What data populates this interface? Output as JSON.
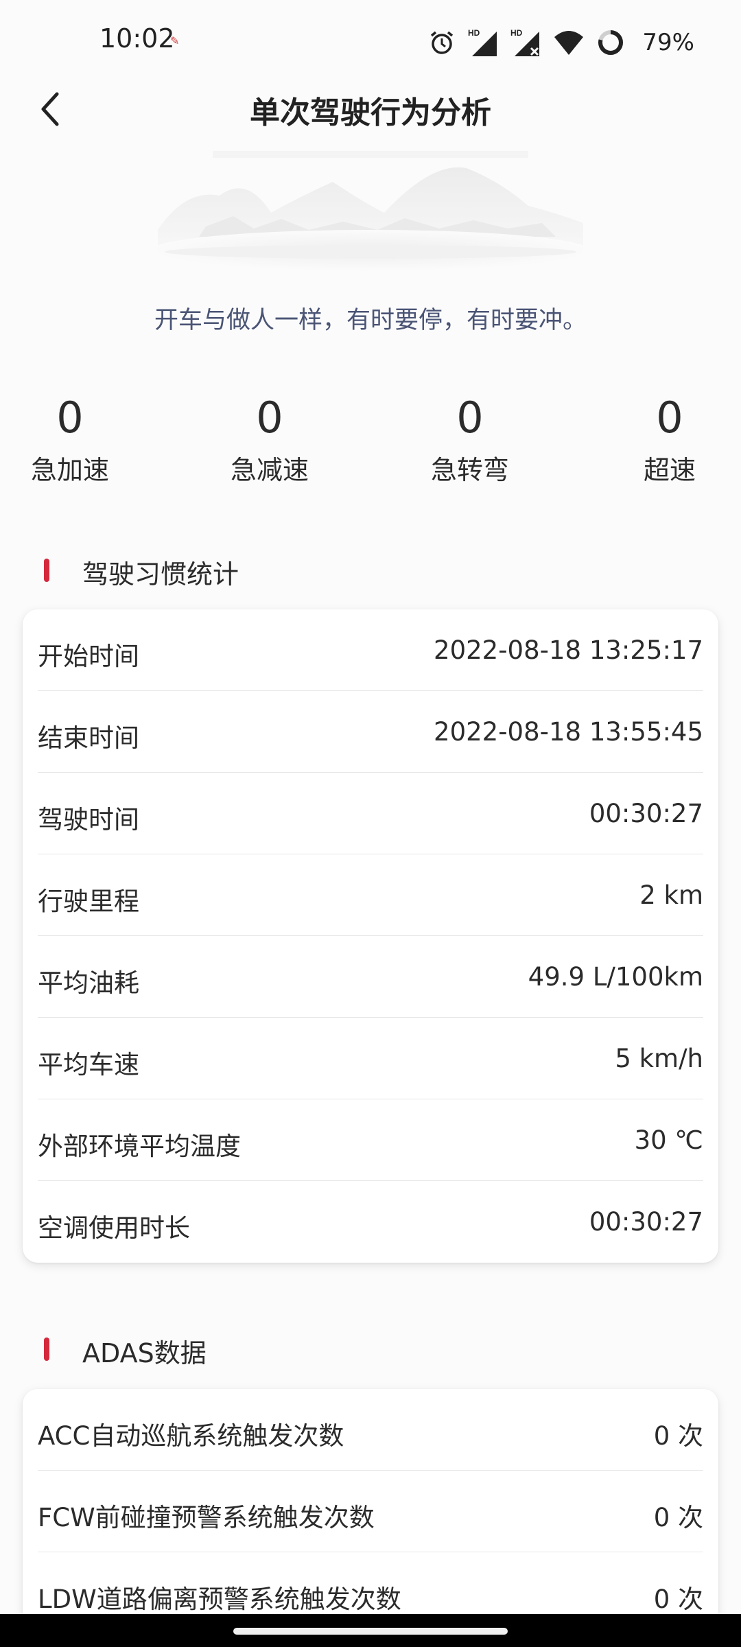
{
  "status_bar": {
    "time": "10:02",
    "battery": "79%",
    "icons": [
      "alarm-icon",
      "hd-signal-icon",
      "hd-signal-icon",
      "wifi-icon",
      "battery-ring-icon"
    ]
  },
  "header": {
    "title": "单次驾驶行为分析",
    "back_icon": "chevron-left-icon"
  },
  "slogan": "开车与做人一样，有时要停，有时要冲。",
  "stats": [
    {
      "value": "0",
      "label": "急加速"
    },
    {
      "value": "0",
      "label": "急减速"
    },
    {
      "value": "0",
      "label": "急转弯"
    },
    {
      "value": "0",
      "label": "超速"
    }
  ],
  "habits": {
    "title": "驾驶习惯统计",
    "rows": [
      {
        "label": "开始时间",
        "value": "2022-08-18 13:25:17"
      },
      {
        "label": "结束时间",
        "value": "2022-08-18 13:55:45"
      },
      {
        "label": "驾驶时间",
        "value": "00:30:27"
      },
      {
        "label": "行驶里程",
        "value": "2 km"
      },
      {
        "label": "平均油耗",
        "value": "49.9 L/100km"
      },
      {
        "label": "平均车速",
        "value": "5 km/h"
      },
      {
        "label": "外部环境平均温度",
        "value": "30 ℃"
      },
      {
        "label": "空调使用时长",
        "value": "00:30:27"
      }
    ]
  },
  "adas": {
    "title": "ADAS数据",
    "rows": [
      {
        "label": "ACC自动巡航系统触发次数",
        "value": "0 次"
      },
      {
        "label": "FCW前碰撞预警系统触发次数",
        "value": "0 次"
      },
      {
        "label": "LDW道路偏离预警系统触发次数",
        "value": "0 次"
      }
    ]
  },
  "colors": {
    "accent": "#d4283c",
    "slogan": "#4a5475",
    "background": "#fbfbfb"
  }
}
